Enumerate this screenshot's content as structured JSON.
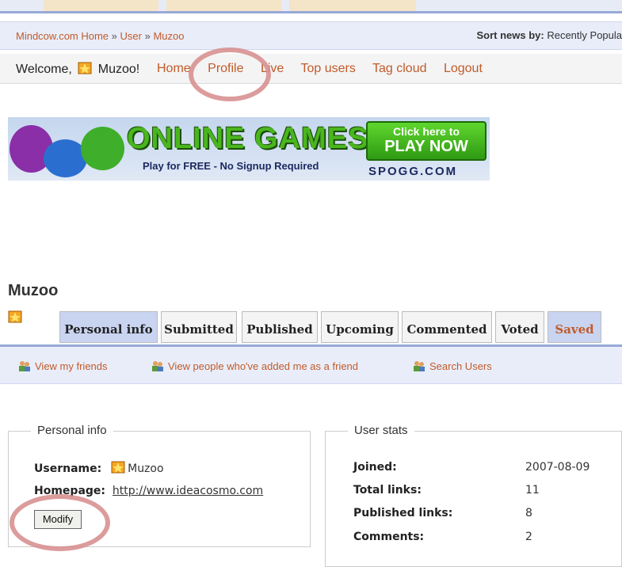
{
  "breadcrumb": {
    "home": "Mindcow.com Home",
    "sep": "»",
    "user": "User",
    "name": "Muzoo"
  },
  "sort": {
    "label": "Sort news by:",
    "value": "Recently Popula"
  },
  "welcome": {
    "prefix": "Welcome,",
    "username": "Muzoo!"
  },
  "menu": {
    "home": "Home",
    "profile": "Profile",
    "live": "Live",
    "top_users": "Top users",
    "tag_cloud": "Tag cloud",
    "logout": "Logout"
  },
  "banner": {
    "title": "ONLINE GAMES",
    "subtitle": "Play for FREE - No Signup Required",
    "cta_line1": "Click here to",
    "cta_line2": "PLAY NOW",
    "brand": "SPOGG.COM"
  },
  "profile": {
    "title": "Muzoo"
  },
  "tabs": [
    "Personal info",
    "Submitted",
    "Published",
    "Upcoming",
    "Commented",
    "Voted",
    "Saved"
  ],
  "friends": {
    "view_friends": "View my friends",
    "added_me": "View people who've added me as a friend",
    "search": "Search Users"
  },
  "personal": {
    "legend": "Personal info",
    "username_label": "Username:",
    "username": "Muzoo",
    "homepage_label": "Homepage:",
    "homepage": "http://www.ideacosmo.com",
    "modify": "Modify"
  },
  "stats": {
    "legend": "User stats",
    "joined_label": "Joined:",
    "joined": "2007-08-09",
    "total_label": "Total links:",
    "total": "11",
    "published_label": "Published links:",
    "published": "8",
    "comments_label": "Comments:",
    "comments": "2"
  },
  "colors": {
    "link": "#c15b2a",
    "tab_active": "#c9d4f1",
    "bar": "#e9edf9",
    "annotation": "#d68b8b"
  }
}
